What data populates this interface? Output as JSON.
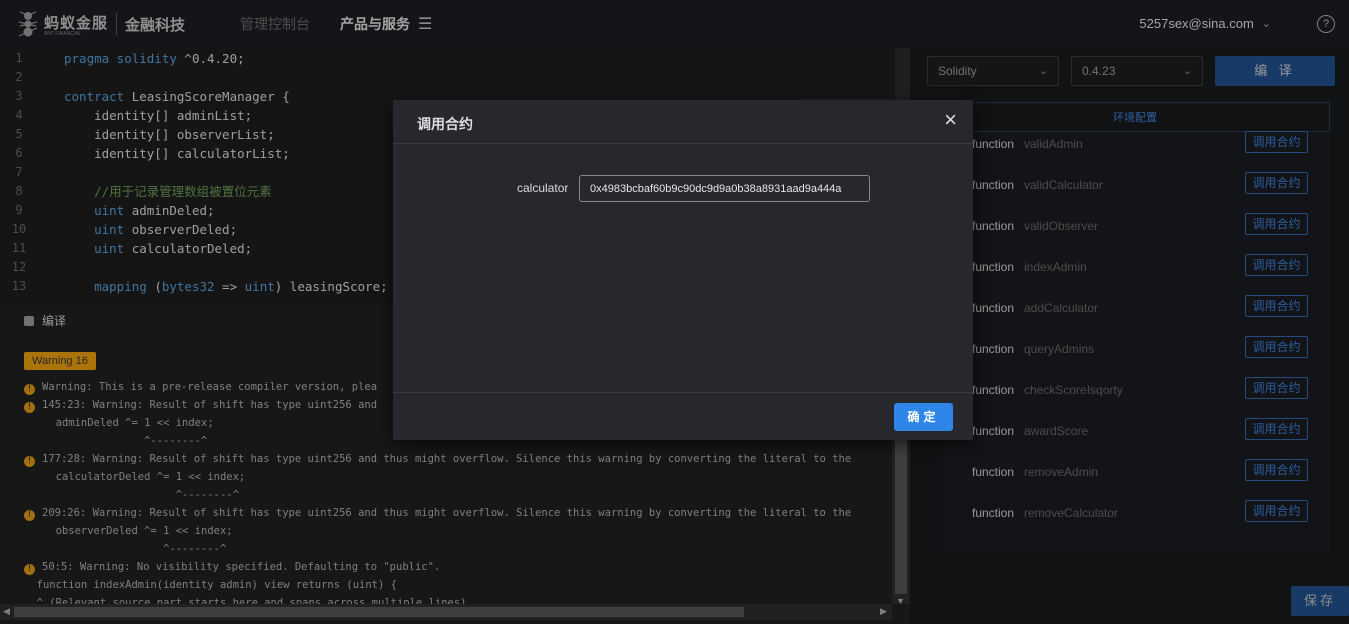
{
  "header": {
    "logo_brand": "蚂蚁金服",
    "logo_sub": "ANT FINANCIAL",
    "logo_fintech": "金融科技",
    "nav_console": "管理控制台",
    "nav_products": "产品与服务",
    "user_email": "5257sex@sina.com",
    "help": "?"
  },
  "editor": {
    "lines": [
      {
        "n": "1",
        "parts": [
          {
            "t": "pragma solidity ",
            "c": "kw"
          },
          {
            "t": "^0.4.20;",
            "c": "df"
          }
        ]
      },
      {
        "n": "2",
        "parts": []
      },
      {
        "n": "3",
        "parts": [
          {
            "t": "contract ",
            "c": "kw"
          },
          {
            "t": "LeasingScoreManager {",
            "c": "df"
          }
        ]
      },
      {
        "n": "4",
        "parts": [
          {
            "t": "    identity[] adminList;",
            "c": "df"
          }
        ]
      },
      {
        "n": "5",
        "parts": [
          {
            "t": "    identity[] observerList;",
            "c": "df"
          }
        ]
      },
      {
        "n": "6",
        "parts": [
          {
            "t": "    identity[] calculatorList;",
            "c": "df"
          }
        ]
      },
      {
        "n": "7",
        "parts": []
      },
      {
        "n": "8",
        "parts": [
          {
            "t": "    //用于记录管理数组被置位元素",
            "c": "cm"
          }
        ]
      },
      {
        "n": "9",
        "parts": [
          {
            "t": "    uint ",
            "c": "kw"
          },
          {
            "t": "adminDeled;",
            "c": "df"
          }
        ]
      },
      {
        "n": "10",
        "parts": [
          {
            "t": "    uint ",
            "c": "kw"
          },
          {
            "t": "observerDeled;",
            "c": "df"
          }
        ]
      },
      {
        "n": "11",
        "parts": [
          {
            "t": "    uint ",
            "c": "kw"
          },
          {
            "t": "calculatorDeled;",
            "c": "df"
          }
        ]
      },
      {
        "n": "12",
        "parts": []
      },
      {
        "n": "13",
        "parts": [
          {
            "t": "    mapping ",
            "c": "kw"
          },
          {
            "t": "(",
            "c": "df"
          },
          {
            "t": "bytes32",
            "c": "kw"
          },
          {
            "t": " => ",
            "c": "df"
          },
          {
            "t": "uint",
            "c": "kw"
          },
          {
            "t": ") leasingScore;",
            "c": "df"
          }
        ]
      }
    ]
  },
  "compile": {
    "label": "编译",
    "warning_badge": "Warning 16",
    "logs": [
      {
        "icon": true,
        "text": "Warning: This is a pre-release compiler version, plea"
      },
      {
        "icon": true,
        "text": "145:23: Warning: Result of shift has type uint256 and"
      },
      {
        "icon": false,
        "text": "     adminDeled ^= 1 << index;"
      },
      {
        "icon": false,
        "text": "                   ^--------^"
      },
      {
        "icon": true,
        "text": "177:28: Warning: Result of shift has type uint256 and thus might overflow. Silence this warning by converting the literal to the"
      },
      {
        "icon": false,
        "text": "     calculatorDeled ^= 1 << index;"
      },
      {
        "icon": false,
        "text": "                        ^--------^"
      },
      {
        "icon": true,
        "text": "209:26: Warning: Result of shift has type uint256 and thus might overflow. Silence this warning by converting the literal to the"
      },
      {
        "icon": false,
        "text": "     observerDeled ^= 1 << index;"
      },
      {
        "icon": false,
        "text": "                      ^--------^"
      },
      {
        "icon": true,
        "text": "50:5: Warning: No visibility specified. Defaulting to \"public\"."
      },
      {
        "icon": false,
        "text": "  function indexAdmin(identity admin) view returns (uint) {"
      },
      {
        "icon": false,
        "text": "  ^ (Relevant source part starts here and spans across multiple lines)."
      }
    ]
  },
  "right": {
    "lang_select": "Solidity",
    "version_select": "0.4.23",
    "compile_button": "编 译",
    "env_tab": "环境配置",
    "function_keyword": "function",
    "call_button": "调用合约",
    "functions": [
      "validAdmin",
      "validCalculator",
      "validObserver",
      "indexAdmin",
      "addCalculator",
      "queryAdmins",
      "checkScoreIsqorty",
      "awardScore",
      "removeAdmin",
      "removeCalculator"
    ],
    "save_button": "保存"
  },
  "modal": {
    "title": "调用合约",
    "close": "×",
    "field_label": "calculator",
    "field_value": "0x4983bcbaf60b9c90dc9d9a0b38a8931aad9a444a",
    "ok_button": "确定"
  }
}
